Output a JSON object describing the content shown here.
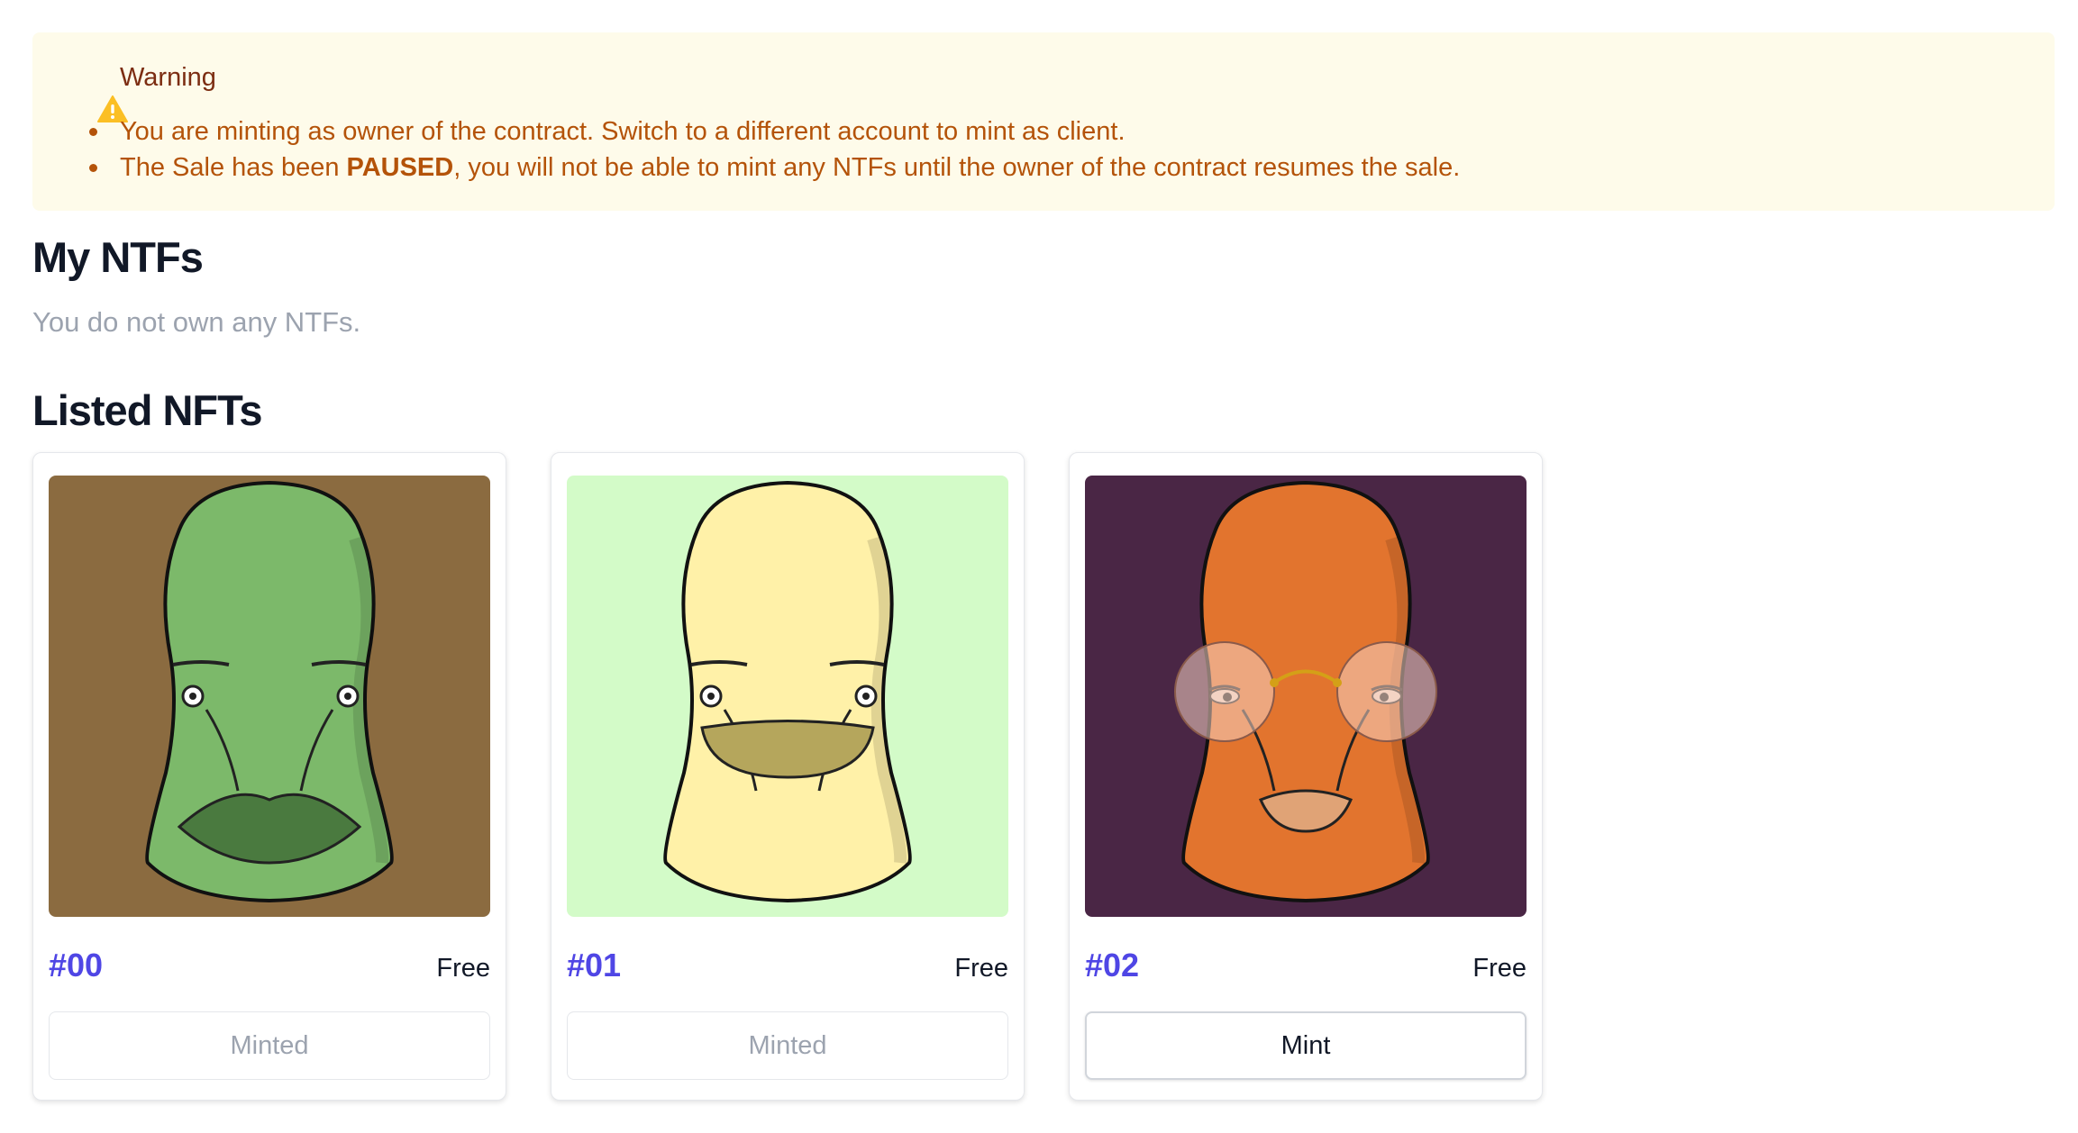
{
  "warning": {
    "title": "Warning",
    "line1": "You are minting as owner of the contract. Switch to a different account to mint as client.",
    "line2_prefix": "The Sale has been ",
    "line2_bold": "PAUSED",
    "line2_suffix": ", you will not be able to mint any NTFs until the owner of the contract resumes the sale."
  },
  "my_nfts": {
    "heading": "My NTFs",
    "empty_text": "You do not own any NTFs."
  },
  "listed": {
    "heading": "Listed NFTs",
    "items": [
      {
        "id": "#00",
        "price": "Free",
        "button": "Minted",
        "bg": "#8b6b40",
        "skin": "#7cb96a",
        "mouth": "#4a7a3f"
      },
      {
        "id": "#01",
        "price": "Free",
        "button": "Minted",
        "bg": "#d3fbc8",
        "skin": "#fff1a8",
        "mouth": "#b5a65c"
      },
      {
        "id": "#02",
        "price": "Free",
        "button": "Mint",
        "bg": "#4a2645",
        "skin": "#e2742e",
        "mouth": "#e0a376"
      }
    ]
  },
  "colors": {
    "warning_bg": "#fefbea",
    "warning_text": "#b45309",
    "accent": "#4f46e5"
  }
}
